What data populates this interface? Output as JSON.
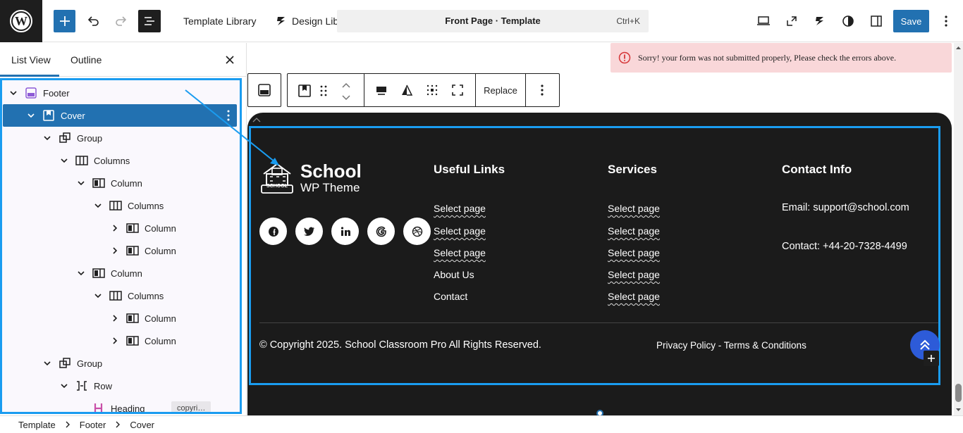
{
  "topbar": {
    "template_library": "Template Library",
    "design_library": "Design Library",
    "command_title": "Front Page · Template",
    "shortcut": "Ctrl+K",
    "save": "Save"
  },
  "sidebar": {
    "tabs": [
      "List View",
      "Outline"
    ],
    "active_tab": "List View",
    "tree": [
      {
        "label": "Footer",
        "depth": 0,
        "icon": "template-part-icon",
        "expanded": true
      },
      {
        "label": "Cover",
        "depth": 1,
        "icon": "cover-icon",
        "expanded": true,
        "selected": true
      },
      {
        "label": "Group",
        "depth": 2,
        "icon": "group-icon",
        "expanded": true
      },
      {
        "label": "Columns",
        "depth": 3,
        "icon": "columns-icon",
        "expanded": true
      },
      {
        "label": "Column",
        "depth": 4,
        "icon": "column-icon",
        "expanded": true
      },
      {
        "label": "Columns",
        "depth": 5,
        "icon": "columns-icon",
        "expanded": true
      },
      {
        "label": "Column",
        "depth": 6,
        "icon": "column-icon",
        "expanded": false
      },
      {
        "label": "Column",
        "depth": 6,
        "icon": "column-icon",
        "expanded": false
      },
      {
        "label": "Column",
        "depth": 4,
        "icon": "column-icon",
        "expanded": true
      },
      {
        "label": "Columns",
        "depth": 5,
        "icon": "columns-icon",
        "expanded": true
      },
      {
        "label": "Column",
        "depth": 6,
        "icon": "column-icon",
        "expanded": false
      },
      {
        "label": "Column",
        "depth": 6,
        "icon": "column-icon",
        "expanded": false
      },
      {
        "label": "Group",
        "depth": 2,
        "icon": "group-icon",
        "expanded": true
      },
      {
        "label": "Row",
        "depth": 3,
        "icon": "row-icon",
        "expanded": true
      },
      {
        "label": "Heading",
        "depth": 4,
        "icon": "heading-icon",
        "badge": "copyri…"
      }
    ]
  },
  "notice": {
    "text": "Sorry! your form was not submitted properly, Please check the errors above."
  },
  "toolbar": {
    "replace": "Replace"
  },
  "footer_content": {
    "logo_title": "School",
    "logo_subtitle": "WP Theme",
    "logo_badge": "SCHOOL",
    "useful_links": {
      "heading": "Useful Links",
      "links": [
        "Select page",
        "Select page",
        "Select page",
        "About Us",
        "Contact"
      ]
    },
    "services": {
      "heading": "Services",
      "links": [
        "Select page",
        "Select page",
        "Select page",
        "Select page",
        "Select page"
      ]
    },
    "contact": {
      "heading": "Contact Info",
      "email": "Email: support@school.com",
      "phone": "Contact: +44-20-7328-4499"
    },
    "social": [
      "facebook-icon",
      "twitter-icon",
      "linkedin-icon",
      "google-icon",
      "dribbble-icon"
    ],
    "copyright": "© Copyright 2025. School Classroom Pro All Rights Reserved.",
    "legal": "Privacy Policy - Terms & Conditions"
  },
  "breadcrumb": [
    "Template",
    "Footer",
    "Cover"
  ],
  "colors": {
    "accent": "#2271b1",
    "highlight_frame": "#1a9cf0",
    "footer_bg": "#1b1b1b",
    "notice_bg": "#f9d7d9",
    "scroll_top_button": "#2d5bd8"
  }
}
